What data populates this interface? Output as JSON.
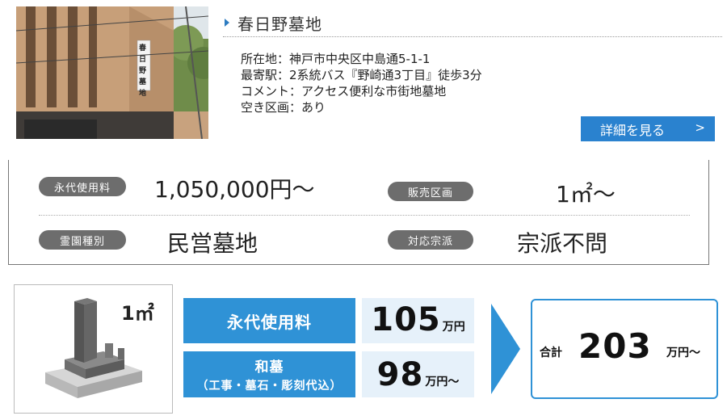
{
  "cemetery": {
    "name": "春日野墓地",
    "photo_sign": "春日野墓地",
    "info": {
      "address": "所在地：神戸市中央区中島通5-1-1",
      "station": "最寄駅：2系統バス『野崎通3丁目』徒歩3分",
      "comment": "コメント：アクセス便利な市街地墓地",
      "availability": "空き区画：あり"
    },
    "detail_button": {
      "label": "詳細を見る",
      "chevron": ">"
    }
  },
  "specs": {
    "perpetual_fee": {
      "label": "永代使用料",
      "value": "1,050,000円～"
    },
    "plot_size": {
      "label": "販売区画",
      "value": "1㎡～"
    },
    "cemetery_type": {
      "label": "霊園種別",
      "value": "民営墓地"
    },
    "religion": {
      "label": "対応宗派",
      "value": "宗派不問"
    }
  },
  "pricing": {
    "grave_size": "1㎡",
    "perpetual_fee": {
      "label": "永代使用料",
      "amount": "105",
      "unit": "万円"
    },
    "grave": {
      "label": "和墓",
      "sublabel": "（工事・墓石・彫刻代込）",
      "amount": "98",
      "unit": "万円～"
    },
    "total": {
      "label": "合計",
      "amount": "203",
      "unit": "万円～"
    }
  },
  "colors": {
    "accent_blue": "#2f92d6",
    "button_blue": "#2a82cf",
    "pill_gray": "#6d6d6d",
    "price_bg": "#e6f1fa"
  }
}
